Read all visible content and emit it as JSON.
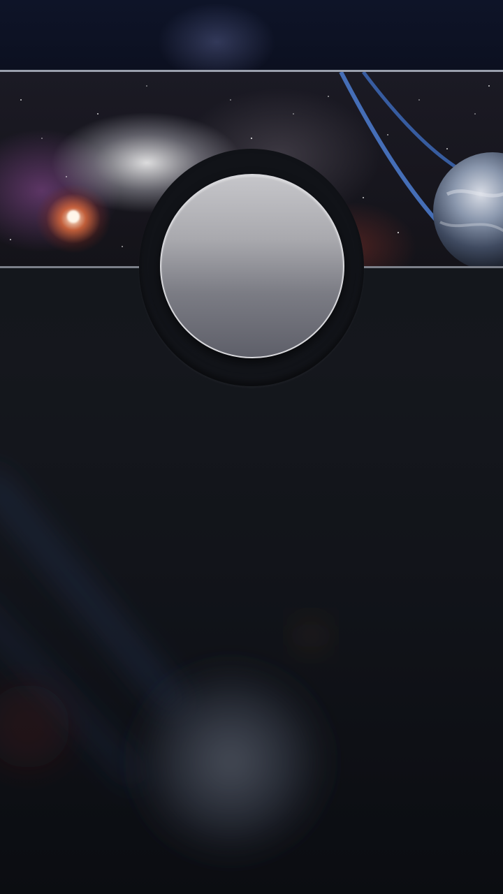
{
  "screen": {
    "background_color": "#0b0d14",
    "accent_color": "#9aa0ad"
  },
  "header_banner": {
    "image_subject": "space-nebula-planet-icon",
    "frame_color": "#9aa0ad"
  },
  "avatar": {
    "icon": "avatar-icon",
    "fill_top": "#c6c6ca",
    "fill_bottom": "#5e5f69",
    "border_color": "#d8d8dc"
  },
  "background": {
    "image_subject": "blurred-planet-icon"
  }
}
